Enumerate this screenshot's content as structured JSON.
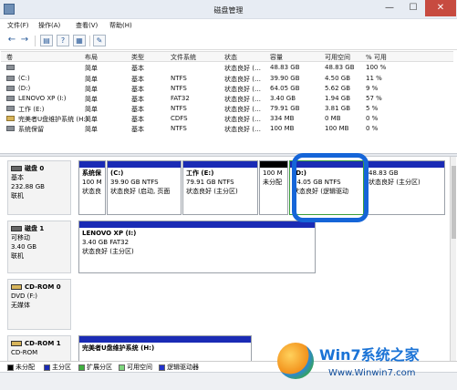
{
  "window": {
    "title": "磁盘管理",
    "min": "—",
    "max": "☐",
    "close": "✕"
  },
  "menu": [
    "文件(F)",
    "操作(A)",
    "查看(V)",
    "帮助(H)"
  ],
  "toolbar": {
    "back": "←",
    "forward": "→",
    "b1": "▤",
    "b2": "?",
    "b3": "▦",
    "b4": "✎"
  },
  "table": {
    "headers": [
      "卷",
      "布局",
      "类型",
      "文件系统",
      "状态",
      "容量",
      "可用空间",
      "% 可用"
    ],
    "rows": [
      [
        "(C:)",
        "简单",
        "基本",
        "NTFS",
        "状态良好 (…",
        "39.90 GB",
        "4.50 GB",
        "11 %"
      ],
      [
        "(D:)",
        "简单",
        "基本",
        "NTFS",
        "状态良好 (…",
        "64.05 GB",
        "5.62 GB",
        "9 %"
      ],
      [
        "LENOVO XP (I:)",
        "简单",
        "基本",
        "FAT32",
        "状态良好 (…",
        "3.40 GB",
        "1.94 GB",
        "57 %"
      ],
      [
        "工作 (E:)",
        "简单",
        "基本",
        "NTFS",
        "状态良好 (…",
        "79.91 GB",
        "3.81 GB",
        "5 %"
      ],
      [
        "完美者U盘维护系统 (H:)",
        "简单",
        "基本",
        "CDFS",
        "状态良好 (…",
        "334 MB",
        "0 MB",
        "0 %"
      ],
      [
        "系统保留",
        "简单",
        "基本",
        "NTFS",
        "状态良好 (…",
        "100 MB",
        "100 MB",
        "0 %"
      ]
    ],
    "first_row": [
      "",
      "简单",
      "基本",
      "",
      "状态良好 (…",
      "48.83 GB",
      "48.83 GB",
      "100 %"
    ]
  },
  "disks": [
    {
      "label": [
        "磁盘 0",
        "基本",
        "232.88 GB",
        "联机"
      ],
      "parts": [
        {
          "name": "系统保",
          "l2": "100 M",
          "l3": "状态良"
        },
        {
          "name": "(C:)",
          "l2": "39.90 GB NTFS",
          "l3": "状态良好 (启动, 页面"
        },
        {
          "name": "工作  (E:)",
          "l2": "79.91 GB NTFS",
          "l3": "状态良好 (主分区)"
        },
        {
          "name": "",
          "l2": "100 M",
          "l3": "未分配"
        },
        {
          "name": "(D:)",
          "l2": "64.05 GB NTFS",
          "l3": "状态良好 (逻辑驱动"
        },
        {
          "name": "",
          "l2": "48.83 GB",
          "l3": "状态良好 (主分区)"
        }
      ]
    },
    {
      "label": [
        "磁盘 1",
        "可移动",
        "3.40 GB",
        "联机"
      ],
      "parts": [
        {
          "name": "LENOVO XP  (I:)",
          "l2": "3.40 GB FAT32",
          "l3": "状态良好 (主分区)"
        }
      ]
    },
    {
      "label": [
        "CD-ROM 0",
        "DVD (F:)",
        "",
        "无媒体"
      ],
      "parts": []
    },
    {
      "label": [
        "CD-ROM 1",
        "CD-ROM",
        "",
        ""
      ],
      "parts": [
        {
          "name": "完美者U盘维护系统  (H:)",
          "l2": "",
          "l3": ""
        }
      ]
    }
  ],
  "legend": [
    "未分配",
    "主分区",
    "扩展分区",
    "可用空间",
    "逻辑驱动器"
  ],
  "legend_colors": [
    "#000000",
    "#1a2bb5",
    "#3fb03f",
    "#7ed67e",
    "#2233cc"
  ],
  "watermark": {
    "t1": "Win7系统之家",
    "t2": "Www.Winwin7.com"
  }
}
